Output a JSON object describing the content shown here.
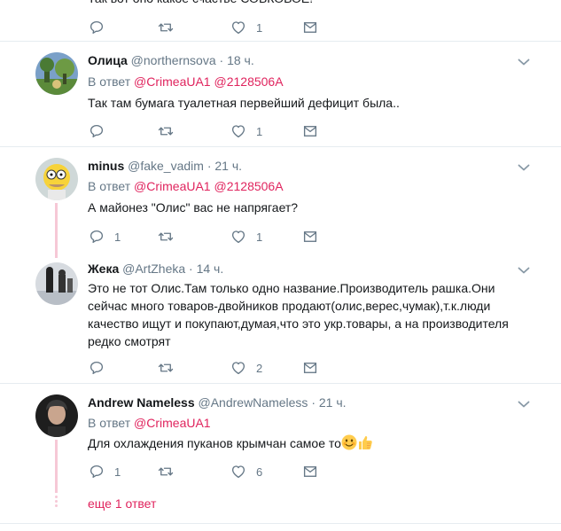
{
  "top_tweet": {
    "text": "Так вот оно какое счастье СОВКОВОЕ!",
    "likes": "1"
  },
  "tweets": [
    {
      "name": "Олица",
      "handle": "@northernsova",
      "time": "18 ч.",
      "reply_prefix": "В ответ",
      "reply_handles": [
        "@CrimeaUA1",
        "@2128506A"
      ],
      "text": "Так там бумага туалетная первейший дефицит была..",
      "replies": "",
      "likes": "1"
    },
    {
      "name": "minus",
      "handle": "@fake_vadim",
      "time": "21 ч.",
      "reply_prefix": "В ответ",
      "reply_handles": [
        "@CrimeaUA1",
        "@2128506A"
      ],
      "text": "А майонез \"Олис\" вас не напрягает?",
      "replies": "1",
      "likes": "1"
    },
    {
      "name": "Жека",
      "handle": "@ArtZheka",
      "time": "14 ч.",
      "text": "Это не тот Олис.Там только одно название.Производитель рашка.Они сейчас много товаров-двойников продают(олис,верес,чумак),т.к.люди качество ищут и покупают,думая,что это укр.товары, а на производителя редко смотрят",
      "replies": "",
      "likes": "2"
    },
    {
      "name": "Andrew Nameless",
      "handle": "@AndrewNameless",
      "time": "21 ч.",
      "reply_prefix": "В ответ",
      "reply_handles": [
        "@CrimeaUA1"
      ],
      "text": "Для охлаждения пуканов крымчан самое то",
      "emojis": [
        "smiling-face-emoji",
        "thumbs-up-emoji"
      ],
      "replies": "1",
      "likes": "6"
    }
  ],
  "more_replies": "еще 1 ответ",
  "colors": {
    "link": "#e0245e",
    "muted": "#657786",
    "divider": "#e6ecf0",
    "thread_line": "#f6c8d6"
  },
  "icons": [
    "reply-icon",
    "retweet-icon",
    "like-icon",
    "dm-icon",
    "chevron-down-icon"
  ]
}
